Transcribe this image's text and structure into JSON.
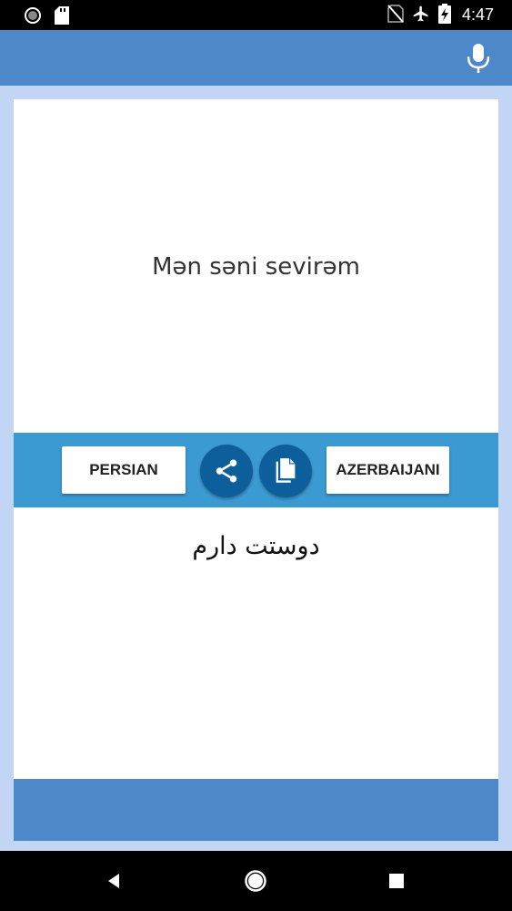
{
  "status_bar": {
    "time": "4:47",
    "icons": [
      "circle-icon",
      "sd-card-icon",
      "no-sim-icon",
      "airplane-icon",
      "battery-charging-icon"
    ]
  },
  "app_bar": {
    "mic_icon": "microphone-icon"
  },
  "source": {
    "text": "Mən səni sevirəm"
  },
  "controls": {
    "source_language": "PERSIAN",
    "target_language": "AZERBAIJANI",
    "share_icon": "share-icon",
    "copy_icon": "copy-icon"
  },
  "target": {
    "text": "دوستت دارم"
  },
  "navigation": {
    "icons": [
      "back-icon",
      "home-icon",
      "recents-icon"
    ]
  },
  "colors": {
    "app_bar": "#4d88c8",
    "controls_bar": "#3c9ad2",
    "circle_button": "#0d5f9c",
    "background": "#c2d5f5"
  }
}
